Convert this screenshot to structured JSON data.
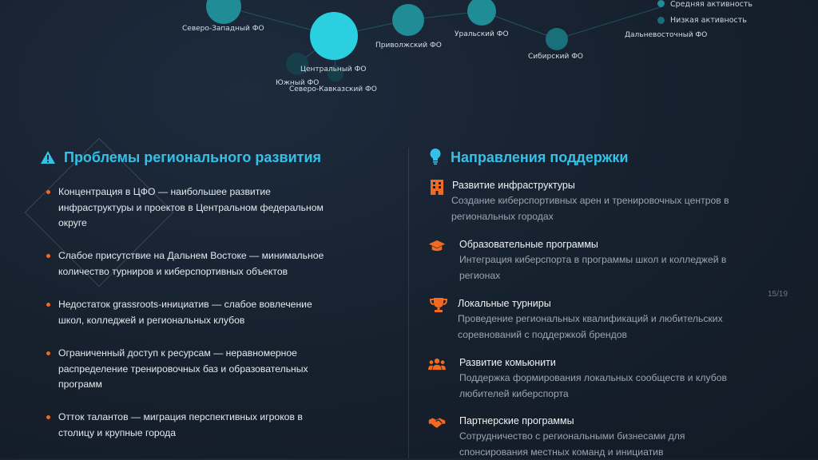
{
  "map": {
    "regions": [
      {
        "label": "Северо-Западный ФО"
      },
      {
        "label": "Центральный ФО"
      },
      {
        "label": "Приволжский ФО"
      },
      {
        "label": "Уральский ФО"
      },
      {
        "label": "Сибирский ФО"
      },
      {
        "label": "Дальневосточный ФО"
      },
      {
        "label": "Южный ФО"
      },
      {
        "label": "Северо-Кавказский ФО"
      }
    ],
    "legend": [
      {
        "label": "Средняя активность"
      },
      {
        "label": "Низкая активность"
      }
    ],
    "bubble_color": "#1f8c96",
    "bubble_highlight": "#2ad0e0"
  },
  "problems": {
    "title": "Проблемы регионального развития",
    "icon": "warning-icon",
    "items": [
      {
        "text": "Концентрация в ЦФО — наибольшее развитие инфраструктуры и проектов в Центральном федеральном округе"
      },
      {
        "text": "Слабое присутствие на Дальнем Востоке — минимальное количество турниров и киберспортивных объектов"
      },
      {
        "text": "Недостаток grassroots-инициатив — слабое вовлечение школ, колледжей и региональных клубов"
      },
      {
        "text": "Ограниченный доступ к ресурсам — неравномерное распределение тренировочных баз и образовательных программ"
      },
      {
        "text": "Отток талантов — миграция перспективных игроков в столицу и крупные города"
      }
    ]
  },
  "support": {
    "title": "Направления поддержки",
    "icon": "lightbulb-icon",
    "items": [
      {
        "title": "Развитие инфраструктуры",
        "desc": "Создание киберспортивных арен и тренировочных центров в региональных городах",
        "icon": "building-icon"
      },
      {
        "title": "Образовательные программы",
        "desc": "Интеграция киберспорта в программы школ и колледжей в регионах",
        "icon": "graduation-cap-icon"
      },
      {
        "title": "Локальные турниры",
        "desc": "Проведение региональных квалификаций и любительских соревнований с поддержкой брендов",
        "icon": "trophy-icon"
      },
      {
        "title": "Развитие комьюнити",
        "desc": "Поддержка формирования локальных сообществ и клубов любителей киберспорта",
        "icon": "users-icon"
      },
      {
        "title": "Партнерские программы",
        "desc": "Сотрудничество с региональными бизнесами для спонсирования местных команд и инициатив",
        "icon": "handshake-icon"
      }
    ]
  },
  "page_number": "15/19",
  "colors": {
    "accent": "#35c0e8",
    "orange": "#f26a22",
    "background": "#16202d"
  }
}
